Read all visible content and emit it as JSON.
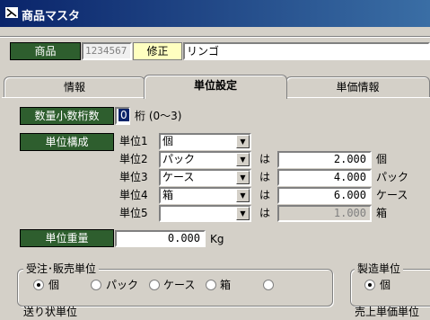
{
  "window": {
    "title": "商品マスタ"
  },
  "header": {
    "product_label": "商品",
    "product_code": "1234567",
    "mode": "修正",
    "product_name": "リンゴ"
  },
  "tabs": [
    {
      "label": "情報"
    },
    {
      "label": "単位設定"
    },
    {
      "label": "単価情報"
    }
  ],
  "decimal": {
    "label": "数量小数桁数",
    "value": "0",
    "suffix": "桁 (0～3)"
  },
  "unit_config": {
    "label": "単位構成",
    "is_text": "は",
    "rows": [
      {
        "label": "単位1",
        "unit": "個"
      },
      {
        "label": "単位2",
        "unit": "パック",
        "qty": "2.000",
        "of": "個"
      },
      {
        "label": "単位3",
        "unit": "ケース",
        "qty": "4.000",
        "of": "パック"
      },
      {
        "label": "単位4",
        "unit": "箱",
        "qty": "6.000",
        "of": "ケース"
      },
      {
        "label": "単位5",
        "unit": "",
        "qty": "1.000",
        "of": "箱"
      }
    ]
  },
  "weight": {
    "label": "単位重量",
    "value": "0.000",
    "unit": "Kg"
  },
  "order_unit": {
    "title": "受注･販売単位",
    "options": [
      "個",
      "パック",
      "ケース",
      "箱",
      ""
    ],
    "selected": 0
  },
  "manufacture_unit": {
    "title": "製造単位",
    "options": [
      "個"
    ],
    "selected": 0
  },
  "footer": {
    "left_label": "送り状単位",
    "right_label": "売上単価単位"
  }
}
